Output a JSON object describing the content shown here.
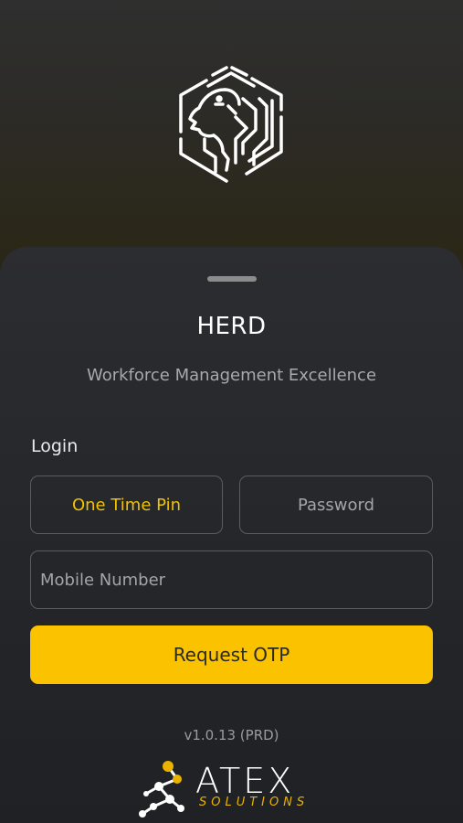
{
  "app": {
    "logo_icon": "lion-hexagon-icon"
  },
  "sheet": {
    "title": "HERD",
    "subtitle": "Workforce Management Excellence",
    "login_label": "Login",
    "tabs": [
      {
        "label": "One Time Pin",
        "active": true
      },
      {
        "label": "Password",
        "active": false
      }
    ],
    "mobile": {
      "placeholder": "Mobile Number",
      "value": ""
    },
    "request_button": "Request OTP",
    "version": "v1.0.13 (PRD)"
  },
  "footer": {
    "brand": "ATEX",
    "brand_sub": "SOLUTIONS",
    "brand_icon": "molecule-network-icon"
  },
  "colors": {
    "accent": "#fbc200",
    "active_tab_text": "#f2c100",
    "sheet_bg": "#26282c"
  }
}
